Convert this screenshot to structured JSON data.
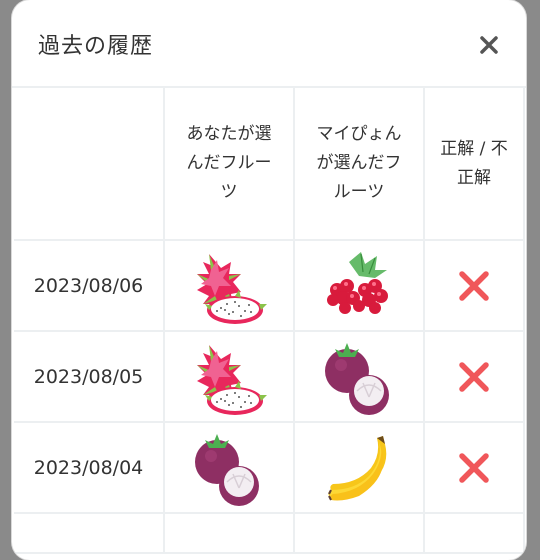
{
  "modal": {
    "title": "過去の履歴",
    "close_icon": "close-icon"
  },
  "table": {
    "headers": {
      "date": "",
      "yours": "あなたが選んだフルーツ",
      "mypyon": "マイぴょんが選んだフルーツ",
      "result": "正解 / 不正解"
    },
    "rows": [
      {
        "date": "2023/08/06",
        "yours": "dragon-fruit-icon",
        "mypyon": "raspberry-icon",
        "result": "incorrect-x-icon"
      },
      {
        "date": "2023/08/05",
        "yours": "dragon-fruit-icon",
        "mypyon": "mangosteen-icon",
        "result": "incorrect-x-icon"
      },
      {
        "date": "2023/08/04",
        "yours": "mangosteen-icon",
        "mypyon": "banana-icon",
        "result": "incorrect-x-icon"
      }
    ]
  },
  "colors": {
    "incorrect": "#f0575a",
    "border": "#eceff1"
  }
}
